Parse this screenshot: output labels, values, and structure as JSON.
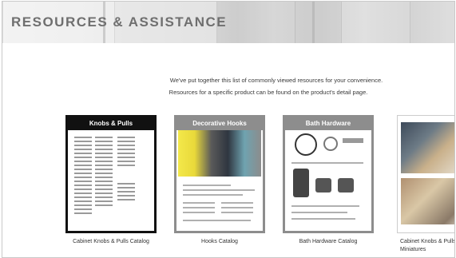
{
  "banner": {
    "title": "RESOURCES & ASSISTANCE"
  },
  "intro": {
    "line1": "We've put together this list of commonly viewed resources for your convenience.",
    "line2": "Resources for a specific product can be found on the product's detail page."
  },
  "catalogs": [
    {
      "header": "Knobs & Pulls",
      "caption": "Cabinet Knobs & Pulls Catalog"
    },
    {
      "header": "Decorative Hooks",
      "caption": "Hooks Catalog"
    },
    {
      "header": "Bath Hardware",
      "caption": "Bath Hardware Catalog"
    },
    {
      "header": "",
      "caption": "Cabinet Knobs & Pulls Miniatures"
    }
  ]
}
